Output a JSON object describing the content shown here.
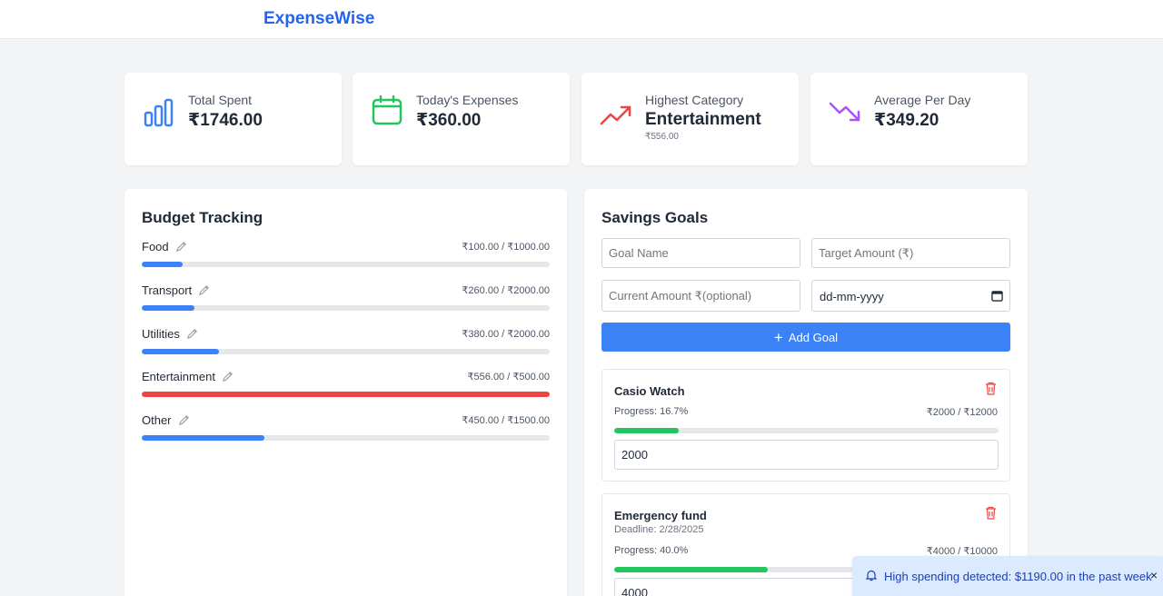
{
  "app": {
    "title": "ExpenseWise"
  },
  "colors": {
    "primary": "#3b82f6",
    "brand": "#2563eb",
    "danger": "#ef4444",
    "success": "#22c55e",
    "purple": "#a855f7"
  },
  "stats": [
    {
      "label": "Total Spent",
      "value": "₹1746.00",
      "icon": "bar-chart-icon"
    },
    {
      "label": "Today's Expenses",
      "value": "₹360.00",
      "icon": "calendar-icon"
    },
    {
      "label": "Highest Category",
      "value": "Entertainment",
      "sub": "₹556.00",
      "icon": "trending-up-icon"
    },
    {
      "label": "Average Per Day",
      "value": "₹349.20",
      "icon": "trending-down-icon"
    }
  ],
  "budget": {
    "title": "Budget Tracking",
    "items": [
      {
        "name": "Food",
        "amount": "₹100.00 / ₹1000.00",
        "fraction": 0.1
      },
      {
        "name": "Transport",
        "amount": "₹260.00 / ₹2000.00",
        "fraction": 0.13
      },
      {
        "name": "Utilities",
        "amount": "₹380.00 / ₹2000.00",
        "fraction": 0.19
      },
      {
        "name": "Entertainment",
        "amount": "₹556.00 / ₹500.00",
        "fraction": 1.0,
        "over": true
      },
      {
        "name": "Other",
        "amount": "₹450.00 / ₹1500.00",
        "fraction": 0.3
      }
    ]
  },
  "savings": {
    "title": "Savings Goals",
    "goal_name_placeholder": "Goal Name",
    "target_placeholder": "Target Amount (₹)",
    "current_placeholder": "Current Amount ₹(optional)",
    "date_placeholder": "dd-mm-yyyy",
    "add_label": "Add Goal",
    "goals": [
      {
        "name": "Casio Watch",
        "deadline": "",
        "progress": "Progress: 16.7%",
        "amount": "₹2000 / ₹12000",
        "fraction": 0.167,
        "value": "2000"
      },
      {
        "name": "Emergency fund",
        "deadline": "Deadline: 2/28/2025",
        "progress": "Progress: 40.0%",
        "amount": "₹4000 / ₹10000",
        "fraction": 0.4,
        "value": "4000"
      }
    ]
  },
  "toast": {
    "message": "High spending detected: $1190.00 in the past week",
    "close": "×"
  }
}
